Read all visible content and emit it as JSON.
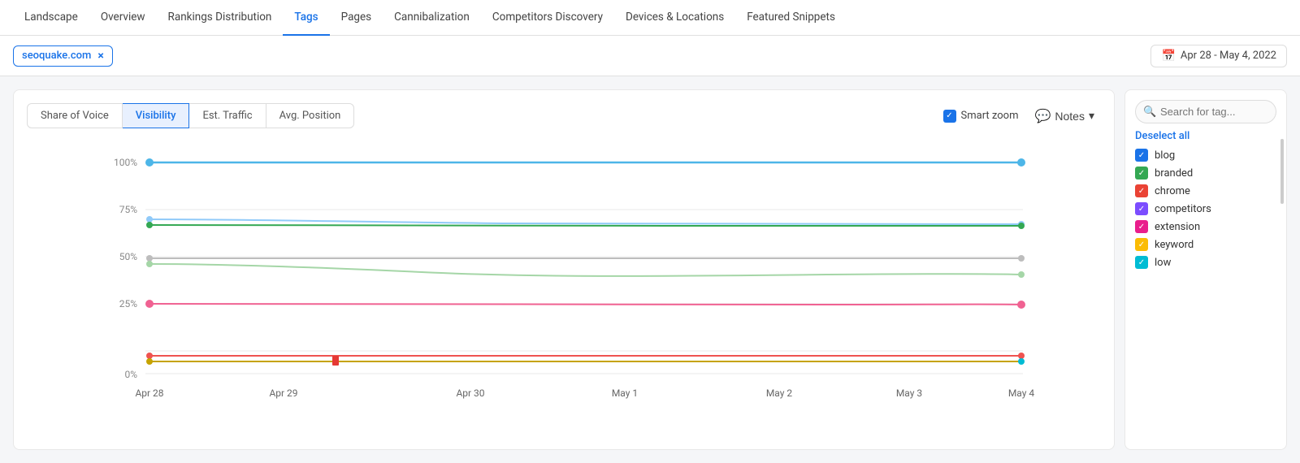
{
  "nav": {
    "items": [
      {
        "label": "Landscape",
        "active": false
      },
      {
        "label": "Overview",
        "active": false
      },
      {
        "label": "Rankings Distribution",
        "active": false
      },
      {
        "label": "Tags",
        "active": true
      },
      {
        "label": "Pages",
        "active": false
      },
      {
        "label": "Cannibalization",
        "active": false
      },
      {
        "label": "Competitors Discovery",
        "active": false
      },
      {
        "label": "Devices & Locations",
        "active": false
      },
      {
        "label": "Featured Snippets",
        "active": false
      }
    ]
  },
  "toolbar": {
    "domain": "seoquake.com",
    "close_label": "×",
    "date_range": "Apr 28 - May 4, 2022"
  },
  "metrics": {
    "tabs": [
      {
        "label": "Share of Voice",
        "active": false
      },
      {
        "label": "Visibility",
        "active": true
      },
      {
        "label": "Est. Traffic",
        "active": false
      },
      {
        "label": "Avg. Position",
        "active": false
      }
    ]
  },
  "controls": {
    "smart_zoom_label": "Smart zoom",
    "notes_label": "Notes",
    "chevron": "▾"
  },
  "chart": {
    "y_labels": [
      "100%",
      "75%",
      "50%",
      "25%",
      "0%"
    ],
    "x_labels": [
      "Apr 28",
      "Apr 29",
      "Apr 30",
      "May 1",
      "May 2",
      "May 3",
      "May 4"
    ]
  },
  "sidebar": {
    "search_placeholder": "Search for tag...",
    "deselect_all": "Deselect all",
    "tags": [
      {
        "label": "blog",
        "color": "#1a73e8",
        "checked": true
      },
      {
        "label": "branded",
        "color": "#34a853",
        "checked": true
      },
      {
        "label": "chrome",
        "color": "#ea4335",
        "checked": true
      },
      {
        "label": "competitors",
        "color": "#7c4dff",
        "checked": true
      },
      {
        "label": "extension",
        "color": "#e91e8c",
        "checked": true
      },
      {
        "label": "keyword",
        "color": "#fbbc04",
        "checked": true
      },
      {
        "label": "low",
        "color": "#00bcd4",
        "checked": true
      }
    ]
  }
}
